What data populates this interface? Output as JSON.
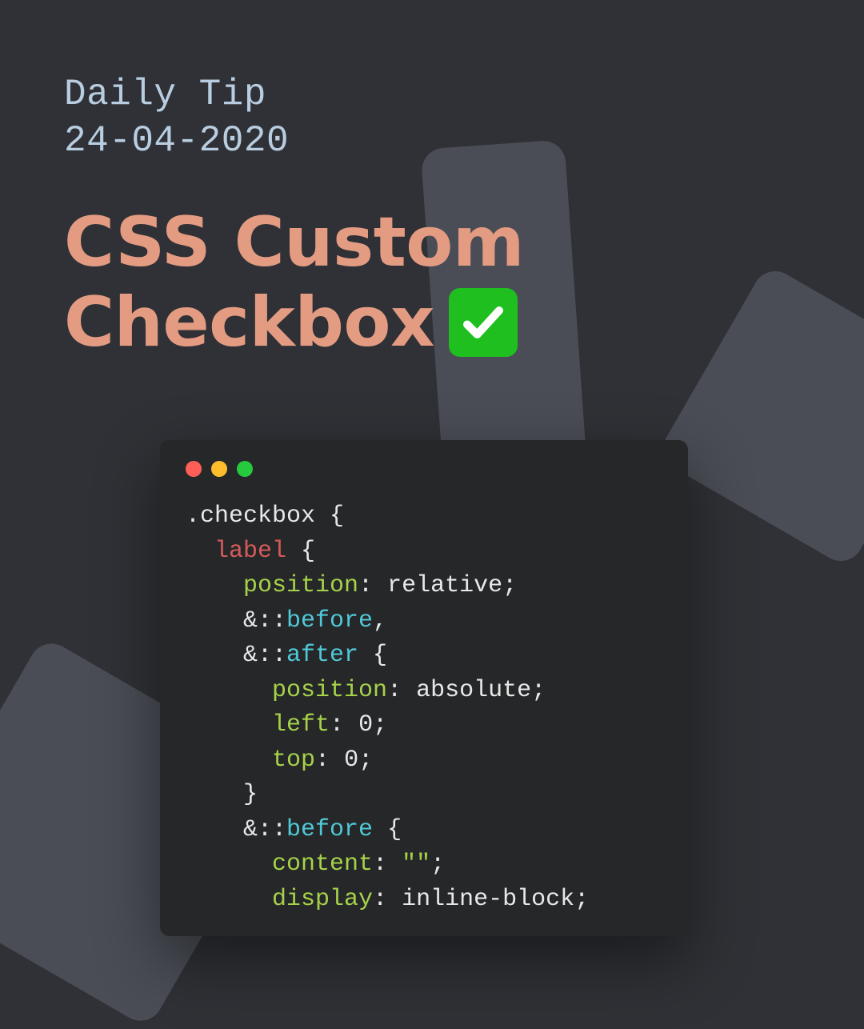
{
  "header": {
    "subtitle_line1": "Daily Tip",
    "subtitle_line2": "24-04-2020",
    "title_line1": "CSS Custom",
    "title_line2": "Checkbox"
  },
  "icon": {
    "name": "check-mark-icon"
  },
  "code": {
    "lines": [
      {
        "indent": 0,
        "tokens": [
          {
            "t": "sel",
            "v": ".checkbox"
          },
          {
            "t": "punct",
            "v": " {"
          }
        ]
      },
      {
        "indent": 1,
        "tokens": [
          {
            "t": "tag",
            "v": "label"
          },
          {
            "t": "punct",
            "v": " {"
          }
        ]
      },
      {
        "indent": 2,
        "tokens": [
          {
            "t": "prop",
            "v": "position"
          },
          {
            "t": "punct",
            "v": ": "
          },
          {
            "t": "val",
            "v": "relative"
          },
          {
            "t": "punct",
            "v": ";"
          }
        ]
      },
      {
        "indent": 2,
        "tokens": [
          {
            "t": "amp",
            "v": "&::"
          },
          {
            "t": "pseudo",
            "v": "before"
          },
          {
            "t": "punct",
            "v": ","
          }
        ]
      },
      {
        "indent": 2,
        "tokens": [
          {
            "t": "amp",
            "v": "&::"
          },
          {
            "t": "pseudo",
            "v": "after"
          },
          {
            "t": "punct",
            "v": " {"
          }
        ]
      },
      {
        "indent": 3,
        "tokens": [
          {
            "t": "prop",
            "v": "position"
          },
          {
            "t": "punct",
            "v": ": "
          },
          {
            "t": "val",
            "v": "absolute"
          },
          {
            "t": "punct",
            "v": ";"
          }
        ]
      },
      {
        "indent": 3,
        "tokens": [
          {
            "t": "prop",
            "v": "left"
          },
          {
            "t": "punct",
            "v": ": "
          },
          {
            "t": "val",
            "v": "0"
          },
          {
            "t": "punct",
            "v": ";"
          }
        ]
      },
      {
        "indent": 3,
        "tokens": [
          {
            "t": "prop",
            "v": "top"
          },
          {
            "t": "punct",
            "v": ": "
          },
          {
            "t": "val",
            "v": "0"
          },
          {
            "t": "punct",
            "v": ";"
          }
        ]
      },
      {
        "indent": 2,
        "tokens": [
          {
            "t": "punct",
            "v": "}"
          }
        ]
      },
      {
        "indent": 2,
        "tokens": [
          {
            "t": "amp",
            "v": "&::"
          },
          {
            "t": "pseudo",
            "v": "before"
          },
          {
            "t": "punct",
            "v": " {"
          }
        ]
      },
      {
        "indent": 3,
        "tokens": [
          {
            "t": "prop",
            "v": "content"
          },
          {
            "t": "punct",
            "v": ": "
          },
          {
            "t": "str",
            "v": "\"\""
          },
          {
            "t": "punct",
            "v": ";"
          }
        ]
      },
      {
        "indent": 3,
        "tokens": [
          {
            "t": "prop",
            "v": "display"
          },
          {
            "t": "punct",
            "v": ": "
          },
          {
            "t": "val",
            "v": "inline-block"
          },
          {
            "t": "punct",
            "v": ";"
          }
        ]
      }
    ]
  },
  "colors": {
    "bg": "#2f3136",
    "shape": "#4a4d55",
    "subtitle": "#b8cde0",
    "title": "#e39b82",
    "check_bg": "#1fbf1f",
    "code_bg": "#262729"
  }
}
